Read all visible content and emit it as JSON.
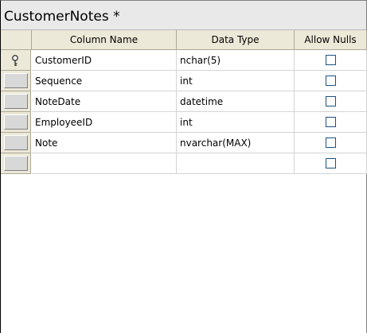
{
  "title": "CustomerNotes *",
  "columns": {
    "name": "Column Name",
    "type": "Data Type",
    "nulls": "Allow Nulls"
  },
  "rows": [
    {
      "name": "CustomerID",
      "type": "nchar(5)",
      "allow_nulls": false,
      "primary_key": true
    },
    {
      "name": "Sequence",
      "type": "int",
      "allow_nulls": false,
      "primary_key": false
    },
    {
      "name": "NoteDate",
      "type": "datetime",
      "allow_nulls": false,
      "primary_key": false
    },
    {
      "name": "EmployeeID",
      "type": "int",
      "allow_nulls": false,
      "primary_key": false
    },
    {
      "name": "Note",
      "type": "nvarchar(MAX)",
      "allow_nulls": false,
      "primary_key": false
    },
    {
      "name": "",
      "type": "",
      "allow_nulls": false,
      "primary_key": false
    }
  ],
  "icons": {
    "primary_key": "key-icon",
    "checkbox": "checkbox-icon"
  },
  "colors": {
    "header_bg": "#ece9d8",
    "title_bar_bg": "#e9e9e9",
    "checkbox_border": "#1c5180"
  }
}
